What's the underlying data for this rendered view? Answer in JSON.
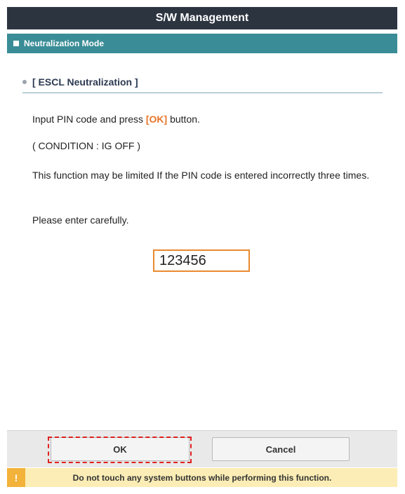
{
  "header": {
    "title": "S/W Management"
  },
  "mode_bar": {
    "label": "Neutralization Mode"
  },
  "section": {
    "title": "[ ESCL Neutralization ]"
  },
  "instructions": {
    "line1_prefix": "Input PIN code and press ",
    "line1_ok": "[OK]",
    "line1_suffix": " button.",
    "condition": "( CONDITION : IG OFF )",
    "warning_line": "This function may be limited If the PIN code is entered incorrectly three times.",
    "careful": "Please enter carefully."
  },
  "pin_input": {
    "value": "123456"
  },
  "buttons": {
    "ok_label": "OK",
    "cancel_label": "Cancel"
  },
  "footer_warning": {
    "icon": "!",
    "text": "Do not touch any system buttons while performing this function."
  },
  "colors": {
    "title_bar": "#2c3440",
    "mode_bar": "#3a8d96",
    "ok_highlight": "#e8742a",
    "input_border": "#e88a30",
    "warning_bg": "#fbedb5",
    "warning_icon": "#f3b23a",
    "ok_outline": "#e02020"
  }
}
